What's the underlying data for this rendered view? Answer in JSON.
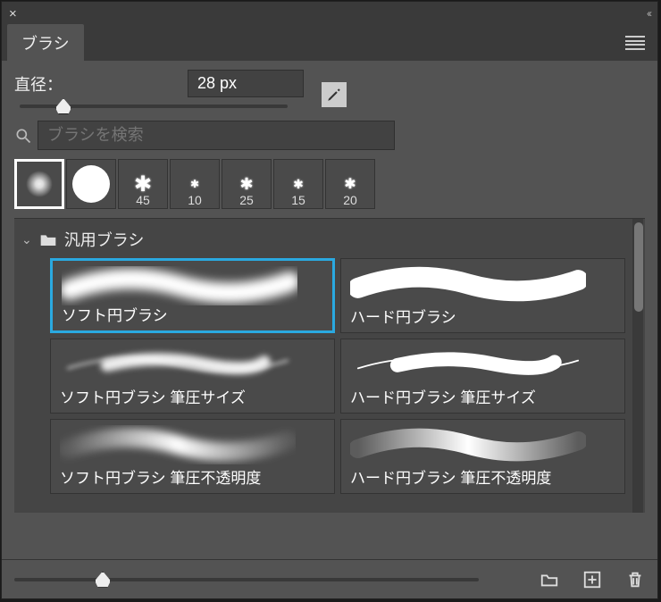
{
  "titlebar": {
    "close_glyph": "×",
    "collapse_glyph": "‹‹"
  },
  "tab": {
    "label": "ブラシ"
  },
  "diameter": {
    "label": "直径：",
    "value": "28 px"
  },
  "search": {
    "placeholder": "ブラシを検索"
  },
  "recent": [
    {
      "label": "",
      "type": "soft",
      "selected": true
    },
    {
      "label": "",
      "type": "hard"
    },
    {
      "label": "45",
      "type": "spatter"
    },
    {
      "label": "10",
      "type": "spatter"
    },
    {
      "label": "25",
      "type": "spatter"
    },
    {
      "label": "15",
      "type": "spatter"
    },
    {
      "label": "20",
      "type": "spatter"
    }
  ],
  "group": {
    "name": "汎用ブラシ",
    "brushes": [
      {
        "name": "ソフト円ブラシ",
        "style": "soft",
        "selected": true
      },
      {
        "name": "ハード円ブラシ",
        "style": "hard"
      },
      {
        "name": "ソフト円ブラシ 筆圧サイズ",
        "style": "soft-thin"
      },
      {
        "name": "ハード円ブラシ 筆圧サイズ",
        "style": "hard-thin"
      },
      {
        "name": "ソフト円ブラシ 筆圧不透明度",
        "style": "soft-fade"
      },
      {
        "name": "ハード円ブラシ 筆圧不透明度",
        "style": "hard-fade"
      }
    ]
  },
  "icons": {
    "search": "search-icon",
    "brush_edit": "brush-edit-icon",
    "menu": "menu-icon",
    "folder": "folder-icon",
    "new_folder": "new-folder-icon",
    "new": "new-icon",
    "trash": "trash-icon"
  }
}
